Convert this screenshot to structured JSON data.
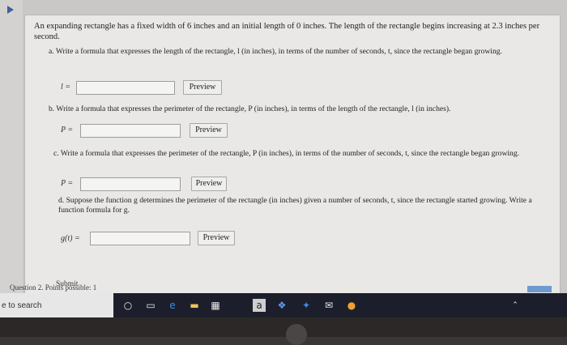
{
  "problem": {
    "intro": "An expanding rectangle has a fixed width of 6 inches and an initial length of 0 inches. The length of the rectangle begins increasing at 2.3 inches per second.",
    "parts": [
      {
        "prompt": "a. Write a formula that expresses the length of the rectangle, l (in inches), in terms of the number of seconds, t, since the rectangle began growing.",
        "var": "l =",
        "answer": "",
        "button": "Preview"
      },
      {
        "prompt": "b. Write a formula that expresses the perimeter of the rectangle, P (in inches), in terms of the length of the rectangle, l (in inches).",
        "var": "P =",
        "answer": "",
        "button": "Preview"
      },
      {
        "prompt": "c. Write a formula that expresses the perimeter of the rectangle, P (in inches), in terms of the number of seconds, t, since the rectangle began growing.",
        "var": "P =",
        "answer": "",
        "button": "Preview"
      },
      {
        "prompt": "d. Suppose the function g determines the perimeter of the rectangle (in inches) given a number of seconds, t, since the rectangle started growing. Write a function formula for g.",
        "var": "g(t) =",
        "answer": "",
        "button": "Preview"
      }
    ],
    "submit_label": "Submit",
    "question_points": "Question 2. Points possible: 1"
  },
  "taskbar": {
    "search_text": "e to search",
    "icons": [
      "cortana-icon",
      "task-view-icon",
      "edge-icon",
      "file-explorer-icon",
      "store-icon",
      "amazon-icon",
      "dropbox-icon",
      "onedrive-icon",
      "mail-icon",
      "music-icon"
    ]
  },
  "colors": {
    "panel": "#e9e8e6",
    "accent": "#3f5f9c",
    "taskbar": "#1c1f2b"
  }
}
